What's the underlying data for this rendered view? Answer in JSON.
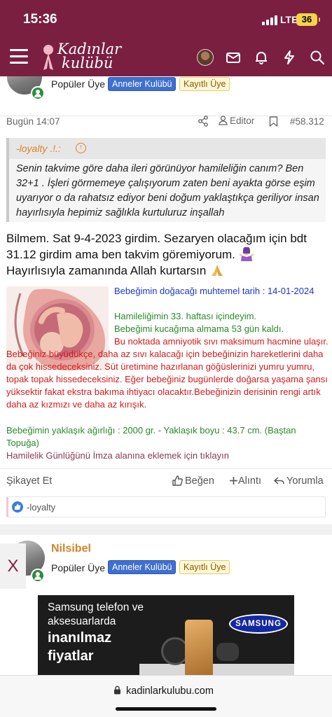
{
  "status_bar": {
    "time": "15:36",
    "network": "LTE",
    "battery": "36"
  },
  "header": {
    "logo_line1": "Kadınlar",
    "logo_line2": "kulübü",
    "icons": [
      "menu-icon",
      "avatar",
      "mail-icon",
      "bell-icon",
      "bolt-icon",
      "search-icon"
    ]
  },
  "post": {
    "user_title": "Popüler Üye",
    "badges": [
      "Anneler Kulübü",
      "Kayıtlı Üye"
    ],
    "date": "Bugün 14:07",
    "editor_label": "Editor",
    "post_number": "#58.312",
    "quote": {
      "author": "-loyalty .!.:",
      "text": "Senin takvime göre daha ileri görünüyor hamileliğin canım? Ben 32+1 . İşleri görmemeye çalışıyorum zaten beni ayakta görse eşim uyarıyor o da rahatsız ediyor beni doğum yaklaştıkça geriliyor insan hayırlısıyla hepimiz sağlıkla kurtuluruz inşallah"
    },
    "body_line1": "Bilmem. Sat 9-4-2023 girdim. Sezaryen olacağım için bdt 31.12 girdim ama ben takvim göremiyorum.",
    "body_line2": "Hayırlısıyla zamanında Allah kurtarsın",
    "signature": {
      "due_date": "Bebeğimin doğacağı muhtemel tarih : 14-01-2024",
      "week": "Hamileliğimin 33. haftası içindeyim.",
      "days_left": "Bebeğimi kucağıma almama 53 gün kaldı.",
      "info_red": "Bu noktada amniyotik sıvı maksimum hacmine ulaşır. Bebeğiniz büyüdükçe, daha az sıvı kalacağı için bebeğinizin hareketlerini daha da çok hissedeceksiniz. Süt üretimine hazırlanan göğüslerinizi yumru yumru, topak topak hissedeceksiniz. Eğer bebeğiniz bugünlerde doğarsa yaşama şansı yüksektir fakat ekstra bakıma ihtiyacı olacaktır.Bebeğinizin derisinin rengi artık daha az kızmızı ve daha az kırışık.",
      "size": "Bebeğimin yaklaşık ağırlığı : 2000 gr. - Yaklaşık boyu : 43.7 cm. (Baştan Topuğa)",
      "link": "Hamilelik Günlüğünü İmza alanına eklemek için tıklayın"
    },
    "actions": {
      "report": "Şikayet Et",
      "like": "Beğen",
      "quote": "Alıntı",
      "reply": "Yorumla"
    },
    "reaction_user": "-loyalty"
  },
  "next_post": {
    "username": "Nilsibel",
    "user_title": "Popüler Üye",
    "badges": [
      "Anneler Kulübü",
      "Kayıtlı Üye"
    ]
  },
  "side_close": "X",
  "ad": {
    "line1": "Samsung telefon ve",
    "line2": "aksesuarlarda",
    "line3": "inanılmaz",
    "line4": "fiyatlar",
    "brand": "SAMSUNG"
  },
  "browser": {
    "url": "kadinlarkulubu.com"
  },
  "colors": {
    "brand": "#7a1f3f",
    "accent_orange": "#d4842a",
    "badge_blue": "#3f6fd0",
    "sig_red": "#d31b1b",
    "sig_green": "#2a8a2a",
    "sig_blue": "#1a37c8"
  }
}
